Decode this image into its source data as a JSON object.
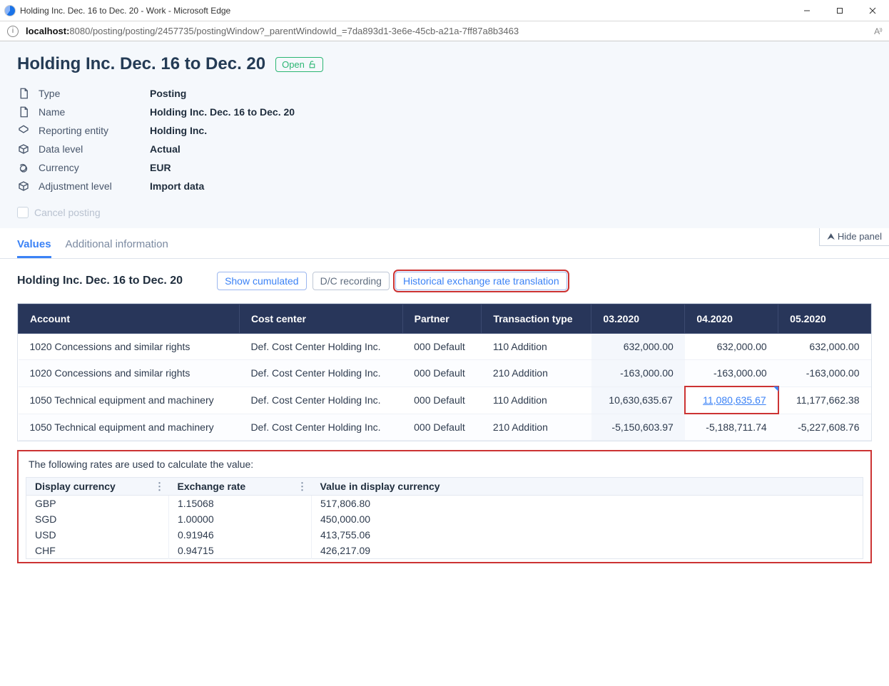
{
  "window": {
    "title": "Holding Inc. Dec. 16 to Dec. 20 - Work - Microsoft Edge"
  },
  "address": {
    "host": "localhost:",
    "port_path": "8080/posting/posting/2457735/postingWindow?_parentWindowId_=7da893d1-3e6e-45cb-a21a-7ff87a8b3463"
  },
  "header": {
    "title": "Holding Inc. Dec. 16 to Dec. 20",
    "status": "Open",
    "meta": {
      "type_label": "Type",
      "type_value": "Posting",
      "name_label": "Name",
      "name_value": "Holding Inc. Dec. 16 to Dec. 20",
      "entity_label": "Reporting entity",
      "entity_value": "Holding Inc.",
      "level_label": "Data level",
      "level_value": "Actual",
      "currency_label": "Currency",
      "currency_value": "EUR",
      "adj_label": "Adjustment level",
      "adj_value": "Import data"
    },
    "cancel_label": "Cancel posting"
  },
  "panel": {
    "hide_label": "Hide panel"
  },
  "tabs": {
    "values": "Values",
    "additional": "Additional information"
  },
  "toolbar": {
    "title": "Holding Inc. Dec. 16 to Dec. 20",
    "show_cumulated": "Show cumulated",
    "dc_recording": "D/C recording",
    "hist_rate": "Historical exchange rate translation"
  },
  "table": {
    "headers": {
      "account": "Account",
      "costcenter": "Cost center",
      "partner": "Partner",
      "txtype": "Transaction type",
      "p1": "03.2020",
      "p2": "04.2020",
      "p3": "05.2020"
    },
    "rows": [
      {
        "account": "1020 Concessions and similar rights",
        "cc": "Def. Cost Center Holding Inc.",
        "partner": "000 Default",
        "tx": "110 Addition",
        "v1": "632,000.00",
        "v2": "632,000.00",
        "v3": "632,000.00"
      },
      {
        "account": "1020 Concessions and similar rights",
        "cc": "Def. Cost Center Holding Inc.",
        "partner": "000 Default",
        "tx": "210 Addition",
        "v1": "-163,000.00",
        "v2": "-163,000.00",
        "v3": "-163,000.00"
      },
      {
        "account": "1050 Technical equipment and machinery",
        "cc": "Def. Cost Center Holding Inc.",
        "partner": "000 Default",
        "tx": "110 Addition",
        "v1": "10,630,635.67",
        "v2": "11,080,635.67",
        "v3": "11,177,662.38",
        "highlight": true
      },
      {
        "account": "1050 Technical equipment and machinery",
        "cc": "Def. Cost Center Holding Inc.",
        "partner": "000 Default",
        "tx": "210 Addition",
        "v1": "-5,150,603.97",
        "v2": "-5,188,711.74",
        "v3": "-5,227,608.76"
      }
    ]
  },
  "rates": {
    "caption": "The following rates are used to calculate the value:",
    "headers": {
      "cur": "Display currency",
      "rate": "Exchange rate",
      "val": "Value in display currency"
    },
    "rows": [
      {
        "cur": "GBP",
        "rate": "1.15068",
        "val": "517,806.80"
      },
      {
        "cur": "SGD",
        "rate": "1.00000",
        "val": "450,000.00"
      },
      {
        "cur": "USD",
        "rate": "0.91946",
        "val": "413,755.06"
      },
      {
        "cur": "CHF",
        "rate": "0.94715",
        "val": "426,217.09"
      }
    ]
  }
}
